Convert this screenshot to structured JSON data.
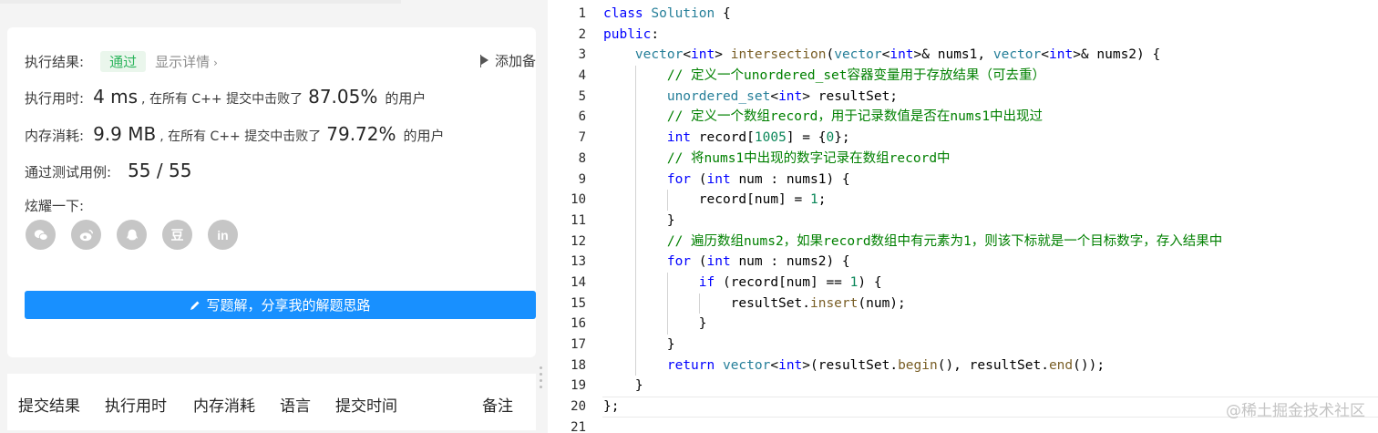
{
  "result": {
    "status_label": "执行结果:",
    "status_value": "通过",
    "detail_link": "显示详情",
    "add_note": "添加备",
    "runtime_label": "执行用时:",
    "runtime_value": "4 ms",
    "runtime_mid": ", 在所有 C++ 提交中击败了",
    "runtime_pct": "87.05%",
    "runtime_tail": "的用户",
    "memory_label": "内存消耗:",
    "memory_value": "9.9 MB",
    "memory_mid": ", 在所有 C++ 提交中击败了",
    "memory_pct": "79.72%",
    "memory_tail": "的用户",
    "tests_label": "通过测试用例:",
    "tests_value": "55 / 55",
    "share_label": "炫耀一下:",
    "share_icons": [
      "wechat-icon",
      "weibo-icon",
      "qq-icon",
      "douban-icon",
      "linkedin-icon"
    ],
    "douban_glyph": "豆",
    "linkedin_glyph": "in",
    "write_button": "写题解，分享我的解题思路"
  },
  "tabs": [
    "提交结果",
    "执行用时",
    "内存消耗",
    "语言",
    "提交时间",
    "备注"
  ],
  "editor": {
    "line_numbers": [
      "1",
      "2",
      "3",
      "4",
      "5",
      "6",
      "7",
      "8",
      "9",
      "10",
      "11",
      "12",
      "13",
      "14",
      "15",
      "16",
      "17",
      "18",
      "19",
      "20",
      "21"
    ],
    "code_lines": [
      "class Solution {",
      "public:",
      "    vector<int> intersection(vector<int>& nums1, vector<int>& nums2) {",
      "        // 定义一个unordered_set容器变量用于存放结果（可去重）",
      "        unordered_set<int> resultSet;",
      "        // 定义一个数组record，用于记录数值是否在nums1中出现过",
      "        int record[1005] = {0};",
      "        // 将nums1中出现的数字记录在数组record中",
      "        for (int num : nums1) {",
      "            record[num] = 1;",
      "        }",
      "        // 遍历数组nums2，如果record数组中有元素为1，则该下标就是一个目标数字，存入结果中",
      "        for (int num : nums2) {",
      "            if (record[num] == 1) {",
      "                resultSet.insert(num);",
      "            }",
      "        }",
      "        return vector<int>(resultSet.begin(), resultSet.end());",
      "    }",
      "};",
      ""
    ]
  },
  "watermark": "@稀土掘金技术社区",
  "colors": {
    "accent": "#1890ff",
    "pass": "#2db55d",
    "keyword": "#0000ff",
    "type": "#267f99",
    "function": "#795e26",
    "number": "#098658",
    "comment": "#008000"
  }
}
